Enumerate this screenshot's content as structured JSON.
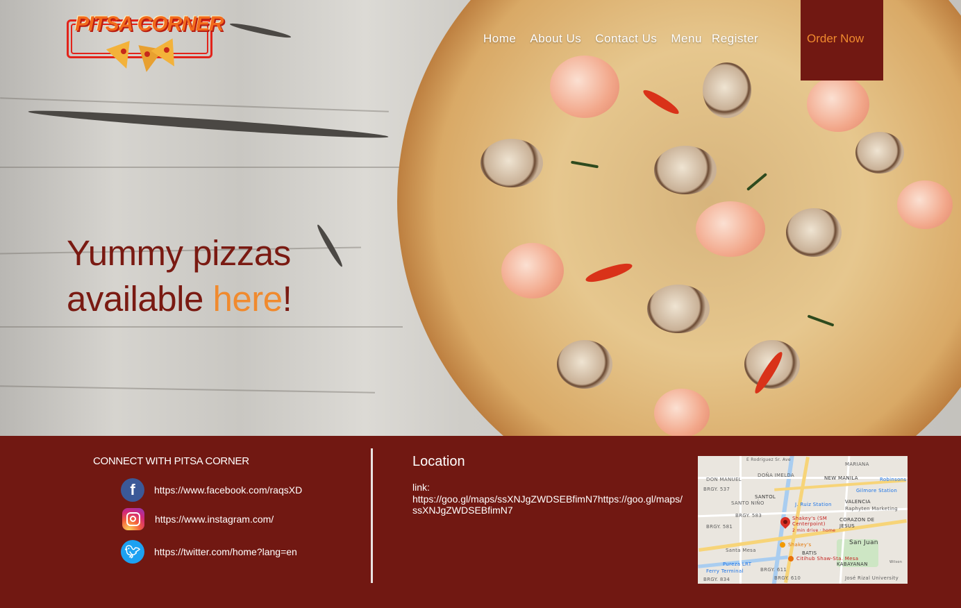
{
  "brand": {
    "name": "PITSA CORNER"
  },
  "nav": {
    "links": [
      "Home",
      "About Us",
      "Contact Us",
      "Menu",
      "Register"
    ],
    "order_label": "Order Now"
  },
  "hero": {
    "line1": "Yummy pizzas",
    "line2_prefix": "available ",
    "line2_accent": "here",
    "line2_suffix": "!"
  },
  "footer": {
    "connect_title": "CONNECT WITH PITSA CORNER",
    "socials": [
      {
        "icon": "facebook-icon",
        "url": "https://www.facebook.com/raqsXD"
      },
      {
        "icon": "instagram-icon",
        "url": "https://www.instagram.com/"
      },
      {
        "icon": "twitter-icon",
        "url": "https://twitter.com/home?lang=en"
      }
    ],
    "location_title": "Location",
    "link_label": "link:",
    "link_url": "https://goo.gl/maps/ssXNJgZWDSEBfimN7https://goo.gl/maps/ssXNJgZWDSEBfimN7"
  },
  "map": {
    "labels": {
      "mariana": "MARIANA",
      "don_manuel": "DON MANUEL",
      "dona_imelda": "DOÑA IMELDA",
      "new_manila": "NEW MANILA",
      "robinsons": "Robinsons",
      "brgy_537": "BRGY. 537",
      "gilmore": "Gilmore Station",
      "santol": "SANTOL",
      "santo_nino": "SANTO NIÑO",
      "j_ruiz": "J. Ruiz Station",
      "valencia": "VALENCIA",
      "raphyten": "Raphyten Marketing",
      "brgy_583": "BRGY. 583",
      "shakeys_sm": "Shakey's (SM Centerpoint)",
      "drive_time": "2 min drive · home",
      "corazon": "CORAZON DE JESUS",
      "brgy_581": "BRGY. 581",
      "shakeys": "Shakey's",
      "san_juan": "San Juan",
      "santa_mesa": "Santa Mesa",
      "batis": "BATIS",
      "citihub": "Citihub Shaw-Sta. Mesa",
      "pureza": "Pureza LRT",
      "kabayanan": "KABAYANAN",
      "brgy_611": "BRGY. 611",
      "perry": "Ferry Terminal",
      "brgy_610": "BRGY. 610",
      "brgy_834": "BRGY. 834",
      "jose_rizal": "José Rizal University",
      "wilson": "Wilson",
      "e_rodriguez": "E Rodriguez Sr. Ave"
    },
    "colors": {
      "pin": "#d93025",
      "water": "#a9cdf0",
      "major_road": "#f7d478"
    }
  },
  "colors": {
    "brand_dark": "#711812",
    "accent_orange": "#f08a2e",
    "headline": "#7a1a12"
  }
}
